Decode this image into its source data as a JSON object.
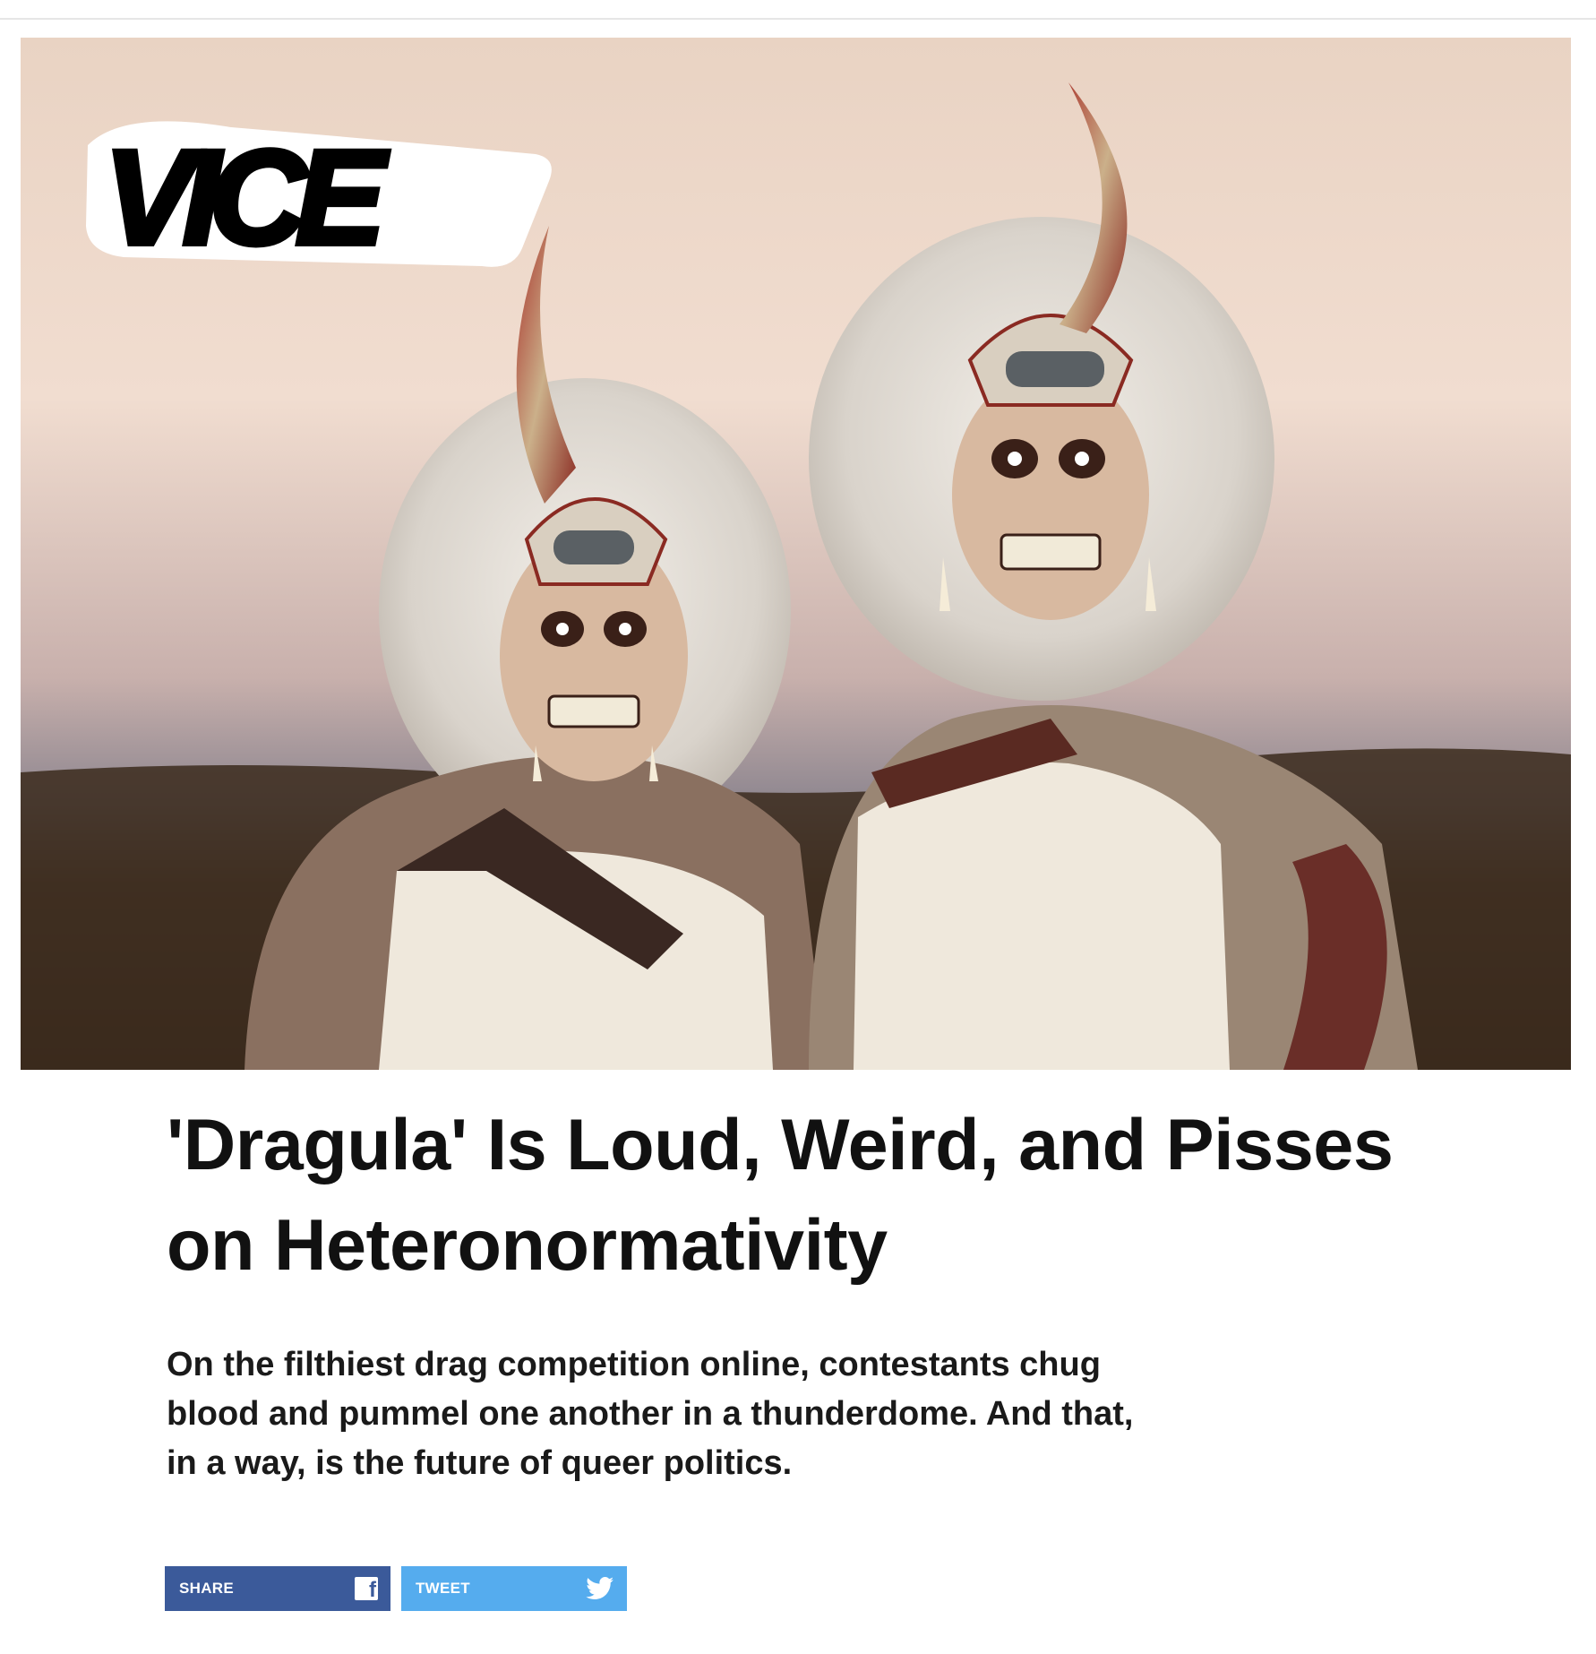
{
  "brand": {
    "logo_text": "VICE"
  },
  "hero": {
    "alt": "Two drag performers in horned skull makeup and white wigs"
  },
  "article": {
    "headline": "'Dragula' Is Loud, Weird, and Pisses on Heteronormativity",
    "dek": "On the filthiest drag competition online, contestants chug blood and pummel one another in a thunderdome. And that, in a way, is the future of queer politics."
  },
  "share": {
    "facebook_label": "SHARE",
    "twitter_label": "TWEET"
  },
  "colors": {
    "facebook": "#3b5a9a",
    "twitter": "#55acee",
    "headline": "#111111"
  },
  "icons": [
    "facebook-icon",
    "twitter-icon"
  ]
}
